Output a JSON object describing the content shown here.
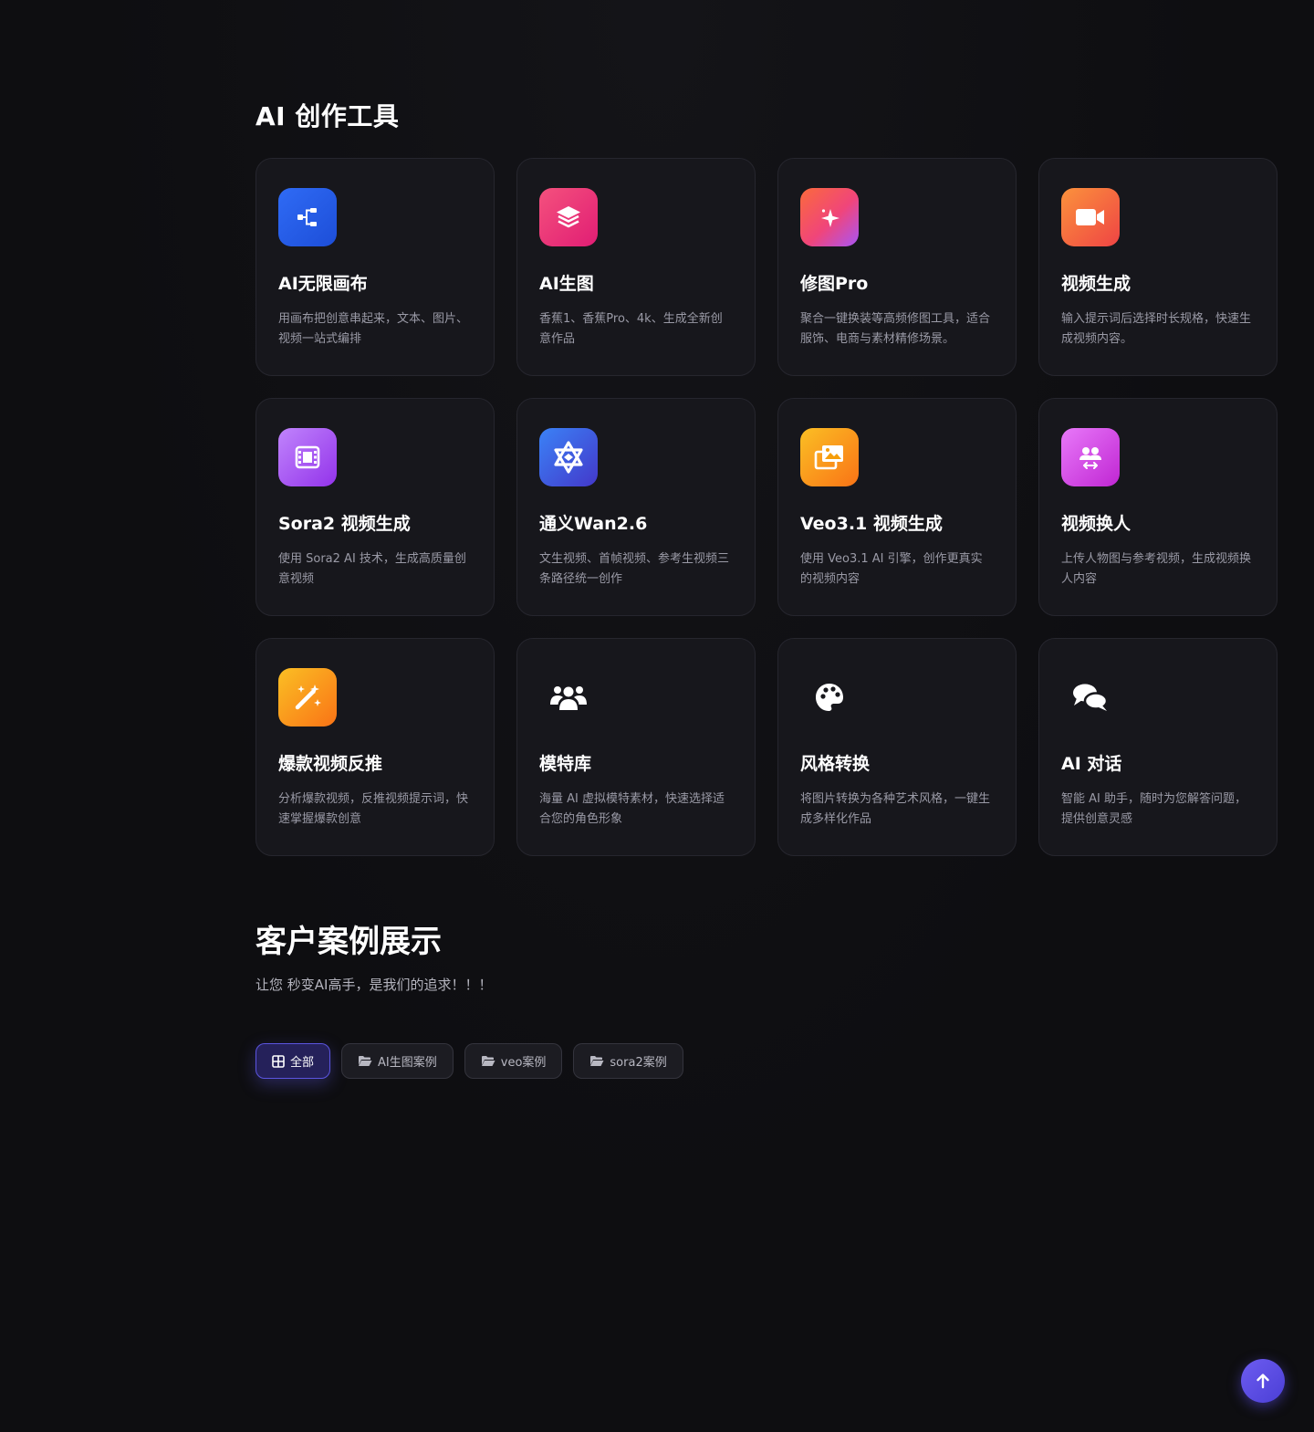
{
  "tools_section": {
    "title": "AI 创作工具",
    "items": [
      {
        "name": "AI无限画布",
        "desc": "用画布把创意串起来，文本、图片、视频一站式编排",
        "icon": "canvas-flow-icon",
        "color": "#2563eb"
      },
      {
        "name": "AI生图",
        "desc": "香蕉1、香蕉Pro、4k、生成全新创意作品",
        "icon": "layers-icon",
        "color": "#ec4899"
      },
      {
        "name": "修图Pro",
        "desc": "聚合一键换装等高频修图工具，适合服饰、电商与素材精修场景。",
        "icon": "sparkle-icon",
        "color": "#f97316"
      },
      {
        "name": "视频生成",
        "desc": "输入提示词后选择时长规格，快速生成视频内容。",
        "icon": "video-camera-icon",
        "color": "#f97316"
      },
      {
        "name": "Sora2 视频生成",
        "desc": "使用 Sora2 AI 技术，生成高质量创意视频",
        "icon": "film-icon",
        "color": "#a855f7"
      },
      {
        "name": "通义Wan2.6",
        "desc": "文生视频、首帧视频、参考生视频三条路径统一创作",
        "icon": "qwen-star-icon",
        "color": "#4f46e5"
      },
      {
        "name": "Veo3.1 视频生成",
        "desc": "使用 Veo3.1 AI 引擎，创作更真实的视频内容",
        "icon": "images-icon",
        "color": "#f59e0b"
      },
      {
        "name": "视频换人",
        "desc": "上传人物图与参考视频，生成视频换人内容",
        "icon": "user-swap-icon",
        "color": "#d946ef"
      },
      {
        "name": "爆款视频反推",
        "desc": "分析爆款视频，反推视频提示词，快速掌握爆款创意",
        "icon": "magic-wand-icon",
        "color": "#f59e0b"
      },
      {
        "name": "模特库",
        "desc": "海量 AI 虚拟模特素材，快速选择适合您的角色形象",
        "icon": "users-icon",
        "color": ""
      },
      {
        "name": "风格转换",
        "desc": "将图片转换为各种艺术风格，一键生成多样化作品",
        "icon": "palette-icon",
        "color": ""
      },
      {
        "name": "AI 对话",
        "desc": "智能 AI 助手，随时为您解答问题，提供创意灵感",
        "icon": "chat-bubbles-icon",
        "color": ""
      }
    ]
  },
  "cases_section": {
    "title": "客户案例展示",
    "subtitle": "让您 秒变AI高手，是我们的追求！！！",
    "filters": [
      {
        "label": "全部",
        "icon": "grid-icon",
        "active": true
      },
      {
        "label": "AI生图案例",
        "icon": "folder-open-icon",
        "active": false
      },
      {
        "label": "veo案例",
        "icon": "folder-open-icon",
        "active": false
      },
      {
        "label": "sora2案例",
        "icon": "folder-open-icon",
        "active": false
      }
    ]
  },
  "back_to_top": {
    "icon": "arrow-up-icon",
    "color": "#5b4be0"
  }
}
